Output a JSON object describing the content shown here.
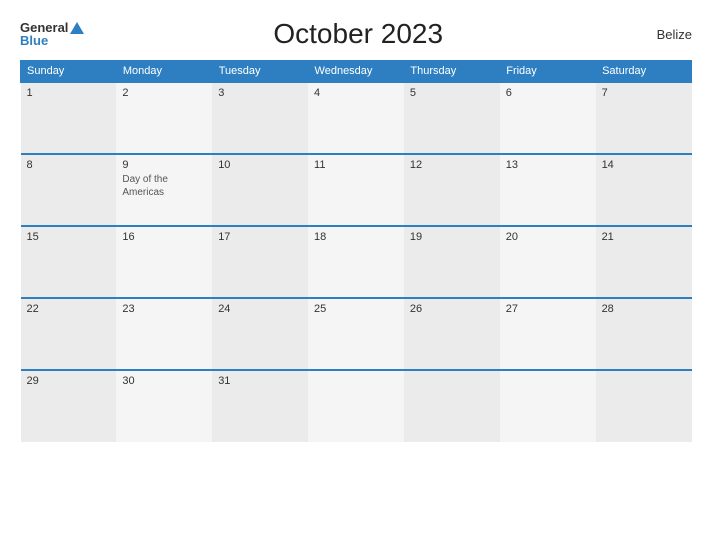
{
  "header": {
    "logo_general": "General",
    "logo_blue": "Blue",
    "title": "October 2023",
    "country": "Belize"
  },
  "days_of_week": [
    "Sunday",
    "Monday",
    "Tuesday",
    "Wednesday",
    "Thursday",
    "Friday",
    "Saturday"
  ],
  "weeks": [
    [
      {
        "day": "1",
        "holiday": ""
      },
      {
        "day": "2",
        "holiday": ""
      },
      {
        "day": "3",
        "holiday": ""
      },
      {
        "day": "4",
        "holiday": ""
      },
      {
        "day": "5",
        "holiday": ""
      },
      {
        "day": "6",
        "holiday": ""
      },
      {
        "day": "7",
        "holiday": ""
      }
    ],
    [
      {
        "day": "8",
        "holiday": ""
      },
      {
        "day": "9",
        "holiday": "Day of the Americas"
      },
      {
        "day": "10",
        "holiday": ""
      },
      {
        "day": "11",
        "holiday": ""
      },
      {
        "day": "12",
        "holiday": ""
      },
      {
        "day": "13",
        "holiday": ""
      },
      {
        "day": "14",
        "holiday": ""
      }
    ],
    [
      {
        "day": "15",
        "holiday": ""
      },
      {
        "day": "16",
        "holiday": ""
      },
      {
        "day": "17",
        "holiday": ""
      },
      {
        "day": "18",
        "holiday": ""
      },
      {
        "day": "19",
        "holiday": ""
      },
      {
        "day": "20",
        "holiday": ""
      },
      {
        "day": "21",
        "holiday": ""
      }
    ],
    [
      {
        "day": "22",
        "holiday": ""
      },
      {
        "day": "23",
        "holiday": ""
      },
      {
        "day": "24",
        "holiday": ""
      },
      {
        "day": "25",
        "holiday": ""
      },
      {
        "day": "26",
        "holiday": ""
      },
      {
        "day": "27",
        "holiday": ""
      },
      {
        "day": "28",
        "holiday": ""
      }
    ],
    [
      {
        "day": "29",
        "holiday": ""
      },
      {
        "day": "30",
        "holiday": ""
      },
      {
        "day": "31",
        "holiday": ""
      },
      {
        "day": "",
        "holiday": ""
      },
      {
        "day": "",
        "holiday": ""
      },
      {
        "day": "",
        "holiday": ""
      },
      {
        "day": "",
        "holiday": ""
      }
    ]
  ]
}
